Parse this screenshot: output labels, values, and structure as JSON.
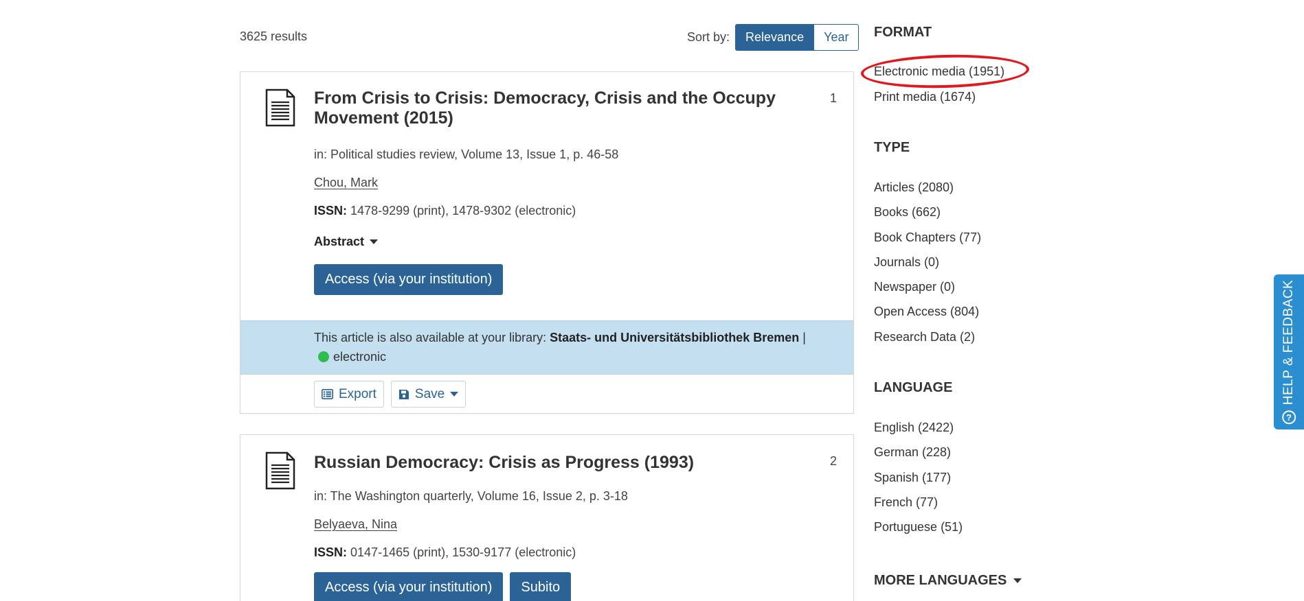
{
  "results": {
    "count_text": "3625 results",
    "sort_label": "Sort by:",
    "sort_options": [
      {
        "label": "Relevance",
        "active": true
      },
      {
        "label": "Year",
        "active": false
      }
    ]
  },
  "items": [
    {
      "number": "1",
      "icon": "document-icon",
      "title": "From Crisis to Crisis: Democracy, Crisis and the Occupy Movement (2015)",
      "source": "in: Political studies review, Volume 13, Issue 1, p. 46-58",
      "author": "Chou, Mark",
      "issn_label": "ISSN:",
      "issn_value": "1478-9299 (print), 1478-9302 (electronic)",
      "abstract_label": "Abstract",
      "access_label": "Access (via your institution)",
      "availability_prefix": "This article is also available at your library:",
      "availability_library": "Staats- und Universitätsbibliothek Bremen",
      "availability_separator": "|",
      "availability_status": "electronic",
      "availability_color": "#2dbd4e",
      "export_label": "Export",
      "save_label": "Save"
    },
    {
      "number": "2",
      "icon": "document-icon",
      "title": "Russian Democracy: Crisis as Progress (1993)",
      "source": "in: The Washington quarterly, Volume 16, Issue 2, p. 3-18",
      "author": "Belyaeva, Nina",
      "issn_label": "ISSN:",
      "issn_value": "0147-1465 (print), 1530-9177 (electronic)",
      "access_label": "Access (via your institution)",
      "subito_label": "Subito"
    }
  ],
  "facets": {
    "format": {
      "heading": "FORMAT",
      "items": [
        "Electronic media (1951)",
        "Print media (1674)"
      ]
    },
    "type": {
      "heading": "TYPE",
      "items": [
        "Articles (2080)",
        "Books (662)",
        "Book Chapters (77)",
        "Journals (0)",
        "Newspaper (0)",
        "Open Access (804)",
        "Research Data (2)"
      ]
    },
    "language": {
      "heading": "LANGUAGE",
      "items": [
        "English (2422)",
        "German (228)",
        "Spanish (177)",
        "French (77)",
        "Portuguese (51)"
      ]
    },
    "more_languages": {
      "heading": "MORE LANGUAGES"
    }
  },
  "feedback": {
    "label": "HELP & FEEDBACK",
    "icon": "help-circle-icon",
    "color": "#2b8ed0"
  },
  "colors": {
    "primary": "#2b6397",
    "availability_bg": "#c3dff0",
    "annotation": "#e0191f"
  }
}
